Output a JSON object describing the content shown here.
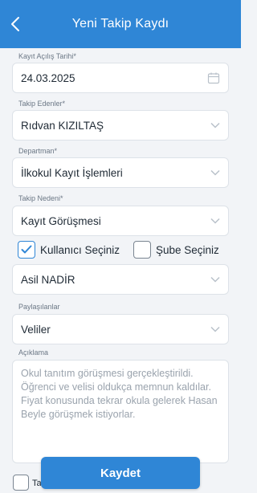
{
  "header": {
    "title": "Yeni Takip Kaydı",
    "back_icon": "chevron-left-icon"
  },
  "form": {
    "date": {
      "label": "Kayıt Açılış Tarihi*",
      "value": "24.03.2025",
      "icon": "calendar-icon"
    },
    "followers": {
      "label": "Takip Edenler*",
      "value": "Rıdvan KIZILTAŞ"
    },
    "department": {
      "label": "Departman*",
      "value": "İlkokul Kayıt İşlemleri"
    },
    "reason": {
      "label": "Takip Nedeni*",
      "value": "Kayıt Görüşmesi"
    },
    "user_select": {
      "label": "Kullanıcı Seçiniz",
      "checked": true
    },
    "branch_select": {
      "label": "Şube Seçiniz",
      "checked": false
    },
    "selected_user": {
      "value": "Asil NADİR"
    },
    "shared_with": {
      "label": "Paylaşılanlar",
      "value": "Veliler"
    },
    "description": {
      "label": "Açıklama",
      "value": "Okul tanıtım görüşmesi gerçekleştirildi. Öğrenci ve velisi oldukça memnun kaldılar. Fiyat konusunda tekrar okula gelerek Hasan Beyle görüşmek istiyorlar."
    },
    "bottom_checkbox": {
      "label": "Ta",
      "checked": false
    }
  },
  "actions": {
    "save_label": "Kaydet"
  },
  "colors": {
    "primary": "#2f86d6",
    "background": "#f2f4f7"
  }
}
